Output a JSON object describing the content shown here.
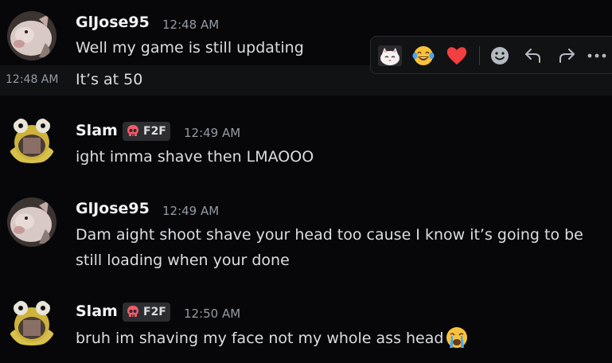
{
  "messages": [
    {
      "username": "GlJose95",
      "timestamp": "12:48 AM",
      "lines": [
        "Well my game is still updating"
      ]
    },
    {
      "side_timestamp": "12:48 AM",
      "lines": [
        "It’s at 50"
      ]
    },
    {
      "username": "Slam",
      "tag": "F2F",
      "timestamp": "12:49 AM",
      "lines": [
        "ight imma shave then LMAOOO"
      ]
    },
    {
      "username": "GlJose95",
      "timestamp": "12:49 AM",
      "lines": [
        "Dam aight shoot shave your head too cause I know it’s going to be",
        "still loading when your done"
      ]
    },
    {
      "username": "Slam",
      "tag": "F2F",
      "timestamp": "12:50 AM",
      "lines": [
        "bruh im shaving my face not my whole ass head"
      ],
      "trailing_emoji": "loudly-crying-face"
    }
  ],
  "toolbar": {
    "reactions": [
      "cat-sticker",
      "face-with-tears-of-joy",
      "red-heart"
    ],
    "actions": [
      "add-reaction",
      "reply",
      "forward",
      "more"
    ]
  },
  "colors": {
    "background": "#070709",
    "hover_background": "#111214",
    "username": "#f2f3f5",
    "text": "#dbdee1",
    "timestamp": "#949ba4",
    "heart": "#f23f42"
  }
}
